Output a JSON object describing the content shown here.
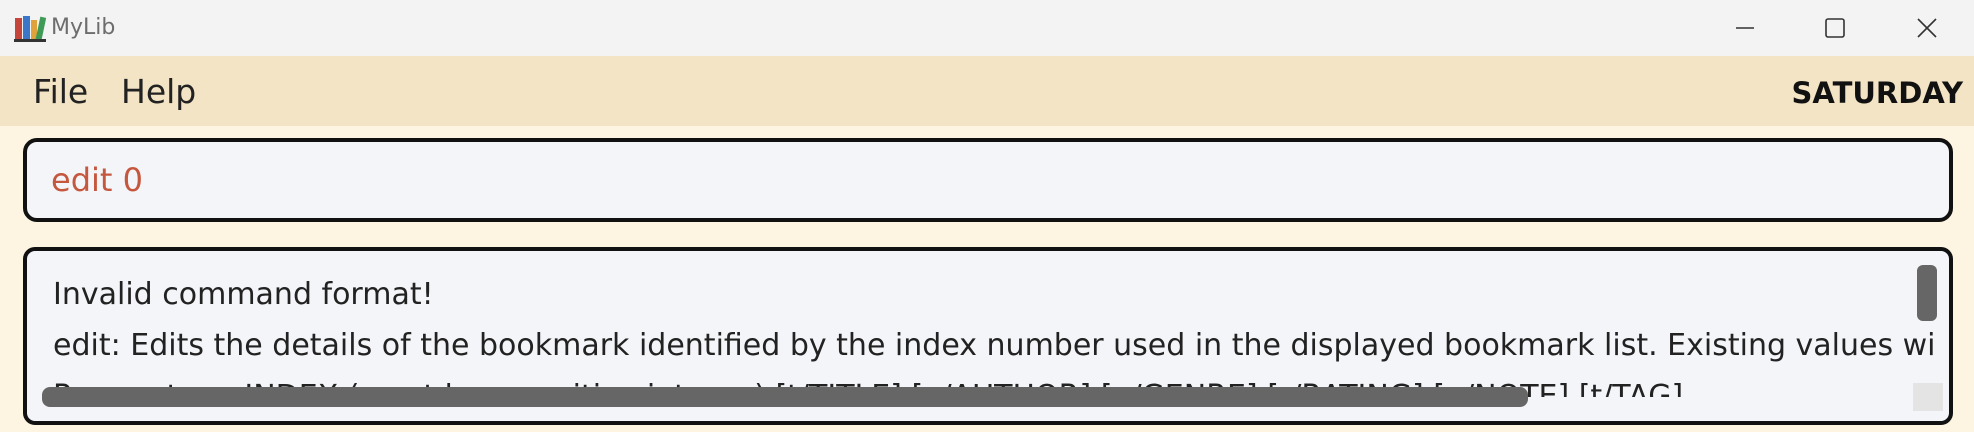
{
  "window": {
    "title": "MyLib",
    "icon": "books-icon",
    "controls": [
      "minimize-icon",
      "maximize-icon",
      "close-icon"
    ]
  },
  "menu": {
    "file_label": "File",
    "help_label": "Help",
    "day": "SATURDAY"
  },
  "command": {
    "value": "edit 0"
  },
  "result": {
    "lines": [
      "Invalid command format!",
      "edit: Edits the details of the bookmark identified by the index number used in the displayed bookmark list. Existing values will be overwritten by the input values.",
      "Parameters: INDEX (must be a positive integer) [t/TITLE] [a/AUTHOR] [g/GENRE] [r/RATING] [n/NOTE] [t/TAG]..."
    ]
  },
  "colors": {
    "titlebar_bg": "#f3f3f3",
    "menubar_bg": "#f2e4c4",
    "body_bg": "#fdf5e2",
    "command_text": "#c5573e",
    "box_bg": "#f4f5f8",
    "scrollbar": "#666666"
  }
}
